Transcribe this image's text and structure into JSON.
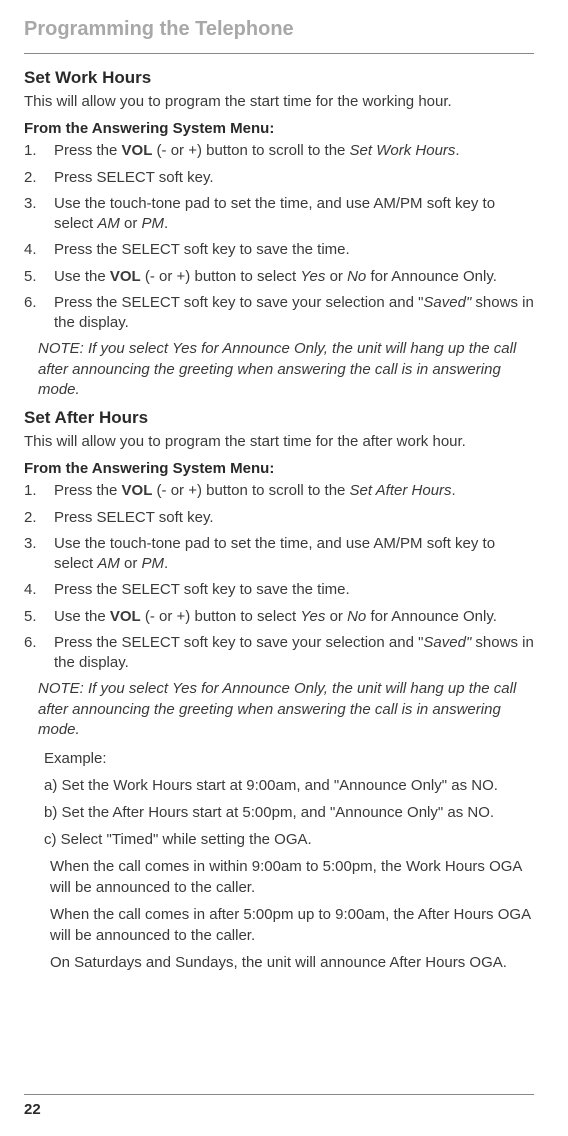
{
  "chapter": "Programming the Telephone",
  "section1": {
    "title": "Set Work Hours",
    "desc": "This will allow you to program the start time for the working hour.",
    "menuHeading": "From the Answering System Menu:",
    "steps": [
      {
        "num": "1.",
        "pre": "Press the ",
        "bold": "VOL",
        "mid": " (- or +) button to scroll to the ",
        "italic": "Set Work Hours",
        "post": "."
      },
      {
        "num": "2.",
        "text": "Press SELECT soft key."
      },
      {
        "num": "3.",
        "pre": "Use the touch-tone pad to set the time, and use AM/PM soft key to select ",
        "italic1": "AM",
        "mid": " or ",
        "italic2": "PM",
        "post": "."
      },
      {
        "num": "4.",
        "text": "Press the SELECT soft key to save the time."
      },
      {
        "num": "5.",
        "pre": "Use the ",
        "bold": "VOL",
        "mid1": " (- or +) button to select ",
        "italic1": "Yes",
        "mid2": " or ",
        "italic2": "No",
        "post": " for Announce Only."
      },
      {
        "num": "6.",
        "pre": "Press the SELECT soft key to save your selection and \"",
        "italic": "Saved\"",
        "post": " shows in the display."
      }
    ],
    "note": "NOTE: If you select Yes for Announce Only, the unit will hang up the call after announcing the greeting when answering the call is in answering mode."
  },
  "section2": {
    "title": "Set After Hours",
    "desc": "This will allow you to program the start time for the after work hour.",
    "menuHeading": "From the Answering System Menu:",
    "steps": [
      {
        "num": "1.",
        "pre": "Press the ",
        "bold": "VOL",
        "mid": " (- or +) button to scroll to the ",
        "italic": "Set After Hours",
        "post": "."
      },
      {
        "num": "2.",
        "text": "Press SELECT soft key."
      },
      {
        "num": "3.",
        "pre": "Use the touch-tone pad to set the time, and use AM/PM soft key to select ",
        "italic1": "AM",
        "mid": " or ",
        "italic2": "PM",
        "post": "."
      },
      {
        "num": "4.",
        "text": "Press the SELECT soft key to save the time."
      },
      {
        "num": "5.",
        "pre": "Use the ",
        "bold": "VOL",
        "mid1": " (- or +) button to select ",
        "italic1": "Yes",
        "mid2": " or ",
        "italic2": "No",
        "post": " for Announce Only."
      },
      {
        "num": "6.",
        "pre": "Press the SELECT soft key to save your selection and \"",
        "italic": "Saved\"",
        "post": " shows in the display."
      }
    ],
    "note": "NOTE: If you select Yes for Announce Only, the unit will hang up the call after announcing the greeting when answering the call is in answering mode."
  },
  "example": {
    "label": "Example:",
    "a": "a) Set the Work Hours start at 9:00am, and \"Announce Only\" as NO.",
    "b": "b) Set the After Hours start at 5:00pm, and \"Announce Only\" as NO.",
    "c": "c) Select \"Timed\" while setting the OGA.",
    "p1": "When the call comes in within 9:00am to 5:00pm, the Work Hours OGA will be announced to the caller.",
    "p2": "When the call comes in after 5:00pm up to 9:00am, the After Hours OGA will be announced to the caller.",
    "p3": "On Saturdays and Sundays, the unit will announce After Hours OGA."
  },
  "pageNum": "22"
}
